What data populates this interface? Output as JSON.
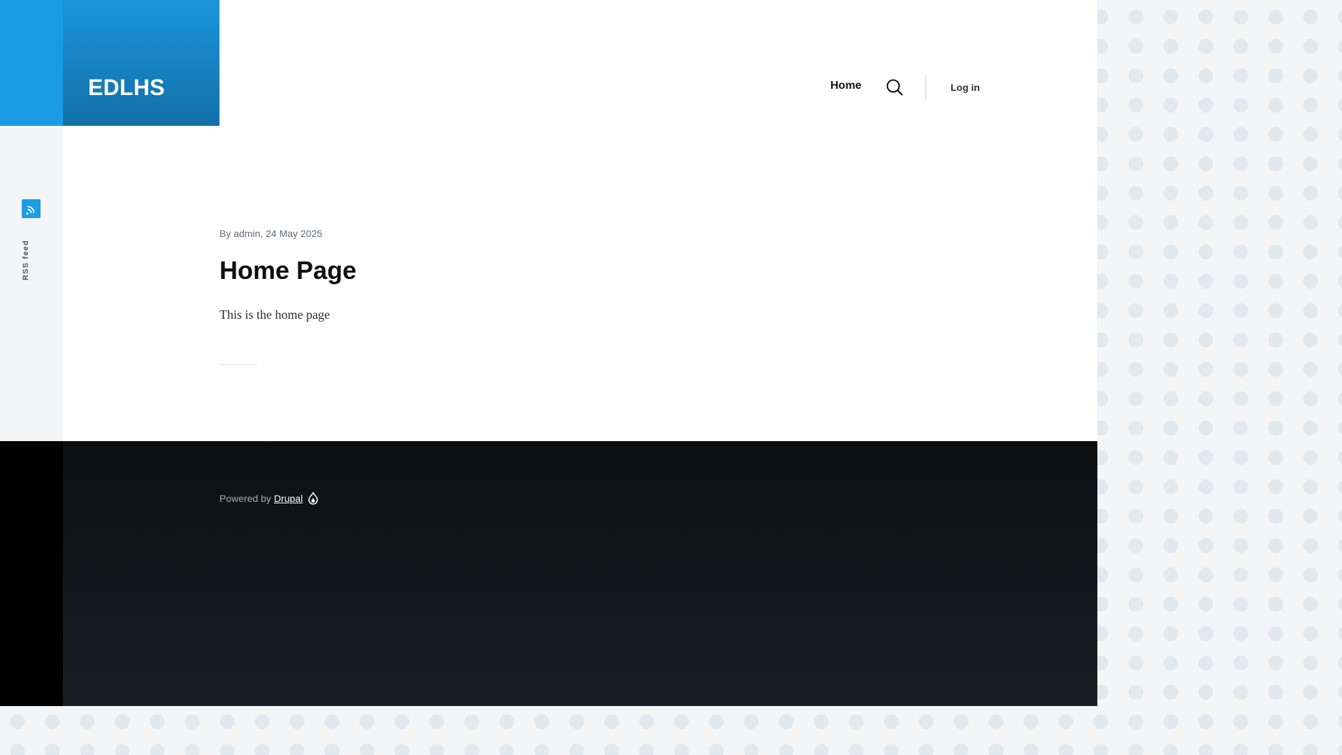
{
  "site": {
    "name": "EDLHS"
  },
  "nav": {
    "home_label": "Home",
    "login_label": "Log in"
  },
  "social": {
    "rss_label": "RSS feed"
  },
  "article": {
    "meta": "By admin, 24 May 2025",
    "title": "Home Page",
    "body": "This is the home page"
  },
  "footer": {
    "powered_prefix": "Powered by",
    "powered_link": "Drupal"
  },
  "icons": {
    "search": "search-icon",
    "rss": "rss-icon",
    "drupal": "drupal-icon"
  },
  "colors": {
    "brand": "#1b9ae4",
    "footer": "#0d0f11"
  }
}
